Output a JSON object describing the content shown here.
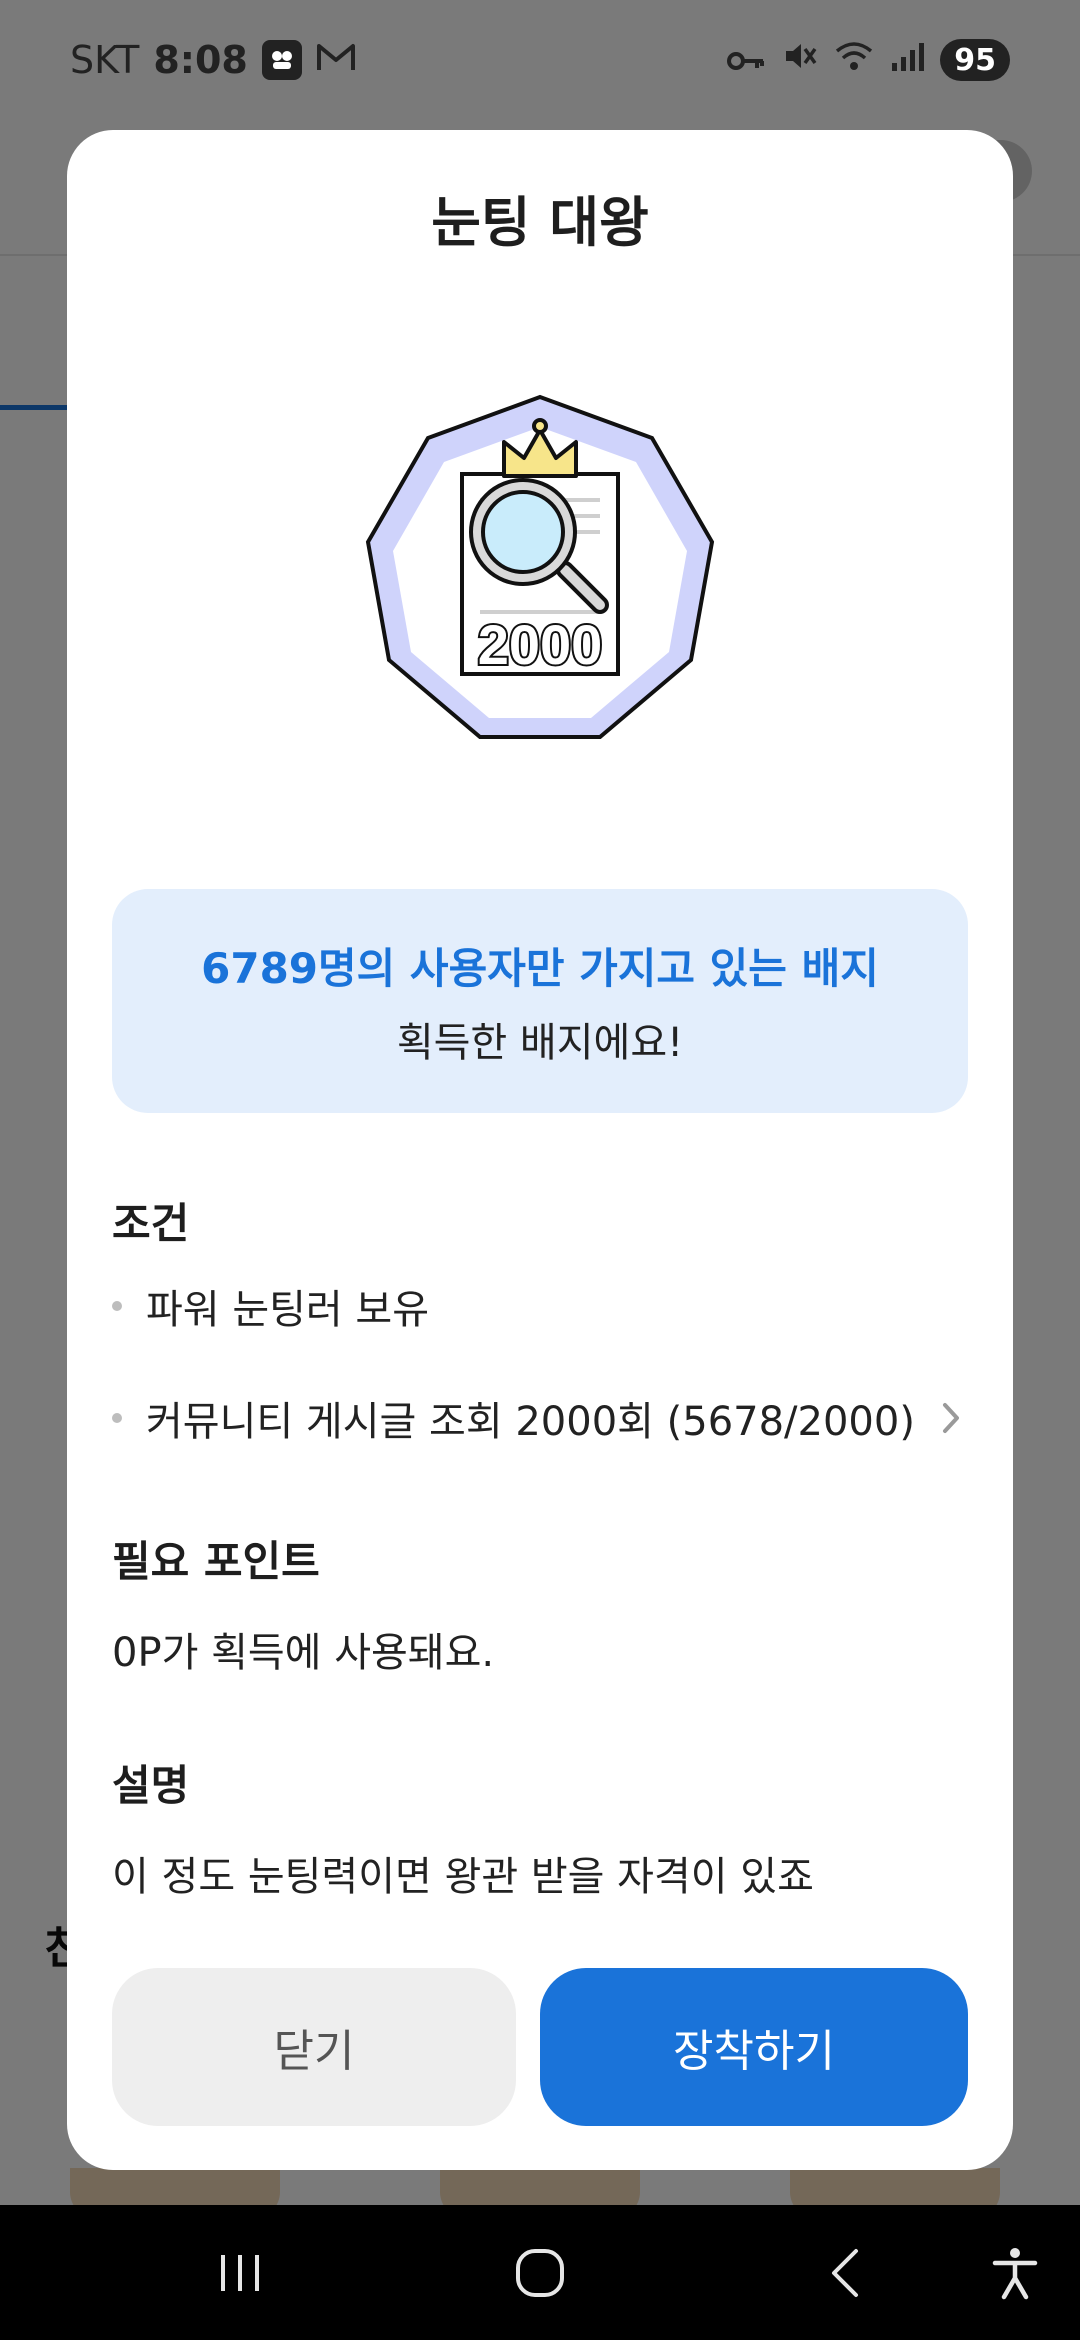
{
  "status_bar": {
    "carrier": "SKT",
    "time": "8:08",
    "battery": "95",
    "icons": [
      "chat-app-icon",
      "gmail-icon",
      "vpn-key-icon",
      "mute-icon",
      "wifi-icon",
      "signal-icon"
    ]
  },
  "background": {
    "peek_text": "친"
  },
  "modal": {
    "title": "눈팅 대왕",
    "badge": {
      "icon": "magnifier-document-crown-badge",
      "number": "2000",
      "colors": {
        "outer": "#cfd3fb",
        "crown": "#f7e58a",
        "lens": "#c9ecfb"
      }
    },
    "rarity": {
      "line1": "6789명의 사용자만 가지고 있는 배지",
      "line2": "획득한 배지에요!"
    },
    "conditions": {
      "heading": "조건",
      "items": [
        {
          "text": "파워 눈팅러 보유",
          "has_link": false
        },
        {
          "text": "커뮤니티 게시글 조회 2000회 (5678/2000)",
          "has_link": true
        }
      ]
    },
    "points": {
      "heading": "필요 포인트",
      "body": "0P가 획득에 사용돼요."
    },
    "description": {
      "heading": "설명",
      "body": "이 정도 눈팅력이면 왕관 받을 자격이 있죠"
    },
    "buttons": {
      "close_label": "닫기",
      "equip_label": "장착하기"
    }
  },
  "colors": {
    "accent": "#1a73d9",
    "rarity_bg": "#e3eefc",
    "close_bg": "#eeeeee"
  },
  "nav_bar": {
    "icons": [
      "recent-apps-icon",
      "home-icon",
      "back-icon",
      "accessibility-icon"
    ]
  }
}
